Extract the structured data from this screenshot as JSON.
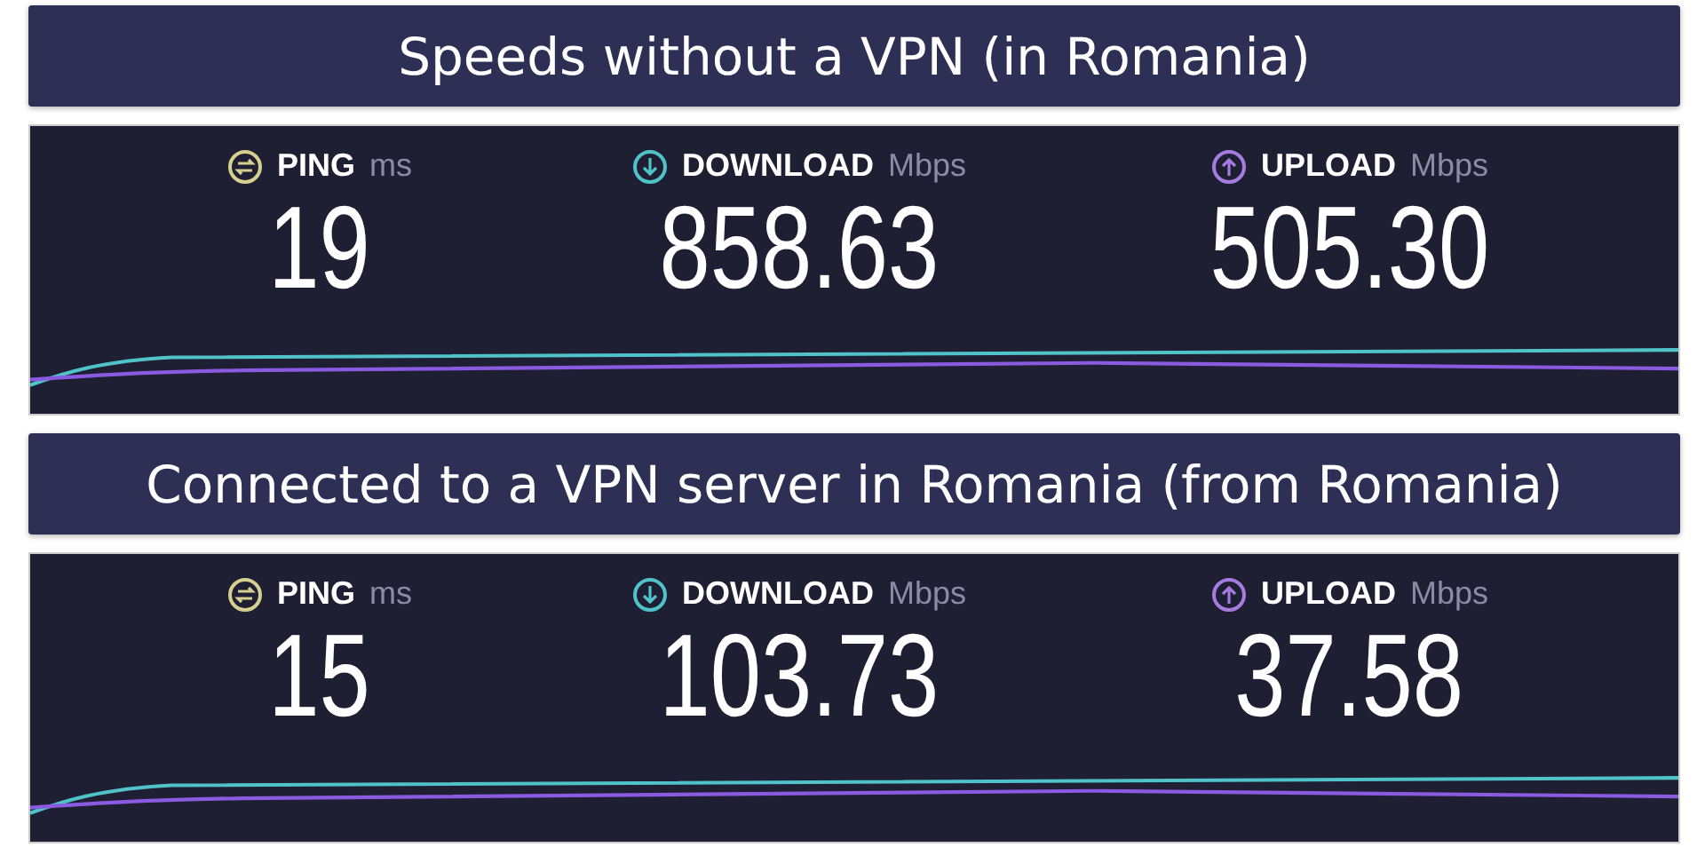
{
  "sections": [
    {
      "title": "Speeds without a VPN (in Romania)",
      "metrics": [
        {
          "kind": "ping",
          "label": "PING",
          "unit": "ms",
          "value": "19"
        },
        {
          "kind": "download",
          "label": "DOWNLOAD",
          "unit": "Mbps",
          "value": "858.63"
        },
        {
          "kind": "upload",
          "label": "UPLOAD",
          "unit": "Mbps",
          "value": "505.30"
        }
      ]
    },
    {
      "title": "Connected to a VPN server in Romania (from Romania)",
      "metrics": [
        {
          "kind": "ping",
          "label": "PING",
          "unit": "ms",
          "value": "15"
        },
        {
          "kind": "download",
          "label": "DOWNLOAD",
          "unit": "Mbps",
          "value": "103.73"
        },
        {
          "kind": "upload",
          "label": "UPLOAD",
          "unit": "Mbps",
          "value": "37.58"
        }
      ]
    }
  ]
}
